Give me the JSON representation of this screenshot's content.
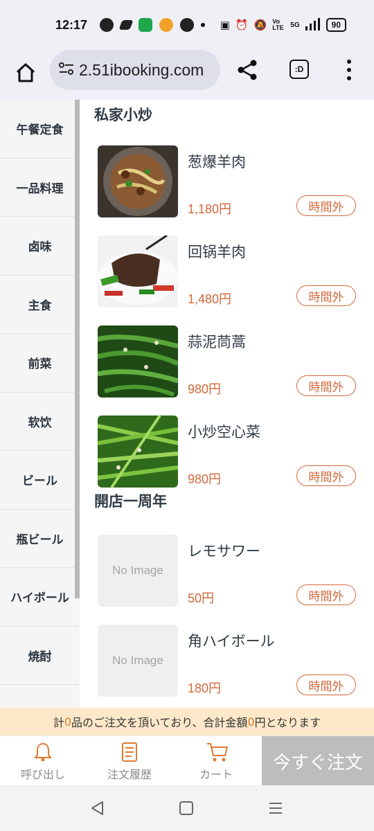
{
  "status_bar": {
    "time": "12:17",
    "signal_text": "5G",
    "volte_text": "Vo LTE",
    "battery": "90"
  },
  "browser": {
    "url": "2.51ibooking.com",
    "tab_label": ":D"
  },
  "sidebar": {
    "items": [
      {
        "label": "午餐定食"
      },
      {
        "label": "一品料理"
      },
      {
        "label": "卤味"
      },
      {
        "label": "主食"
      },
      {
        "label": "前菜"
      },
      {
        "label": "软饮"
      },
      {
        "label": "ビール"
      },
      {
        "label": "瓶ビール"
      },
      {
        "label": "ハイボール"
      },
      {
        "label": "焼酎"
      }
    ]
  },
  "sections": [
    {
      "title": "私家小炒",
      "items": [
        {
          "name": "葱爆羊肉",
          "price": "1,180円",
          "badge": "時間外",
          "image": "lamb-scallion"
        },
        {
          "name": "回锅羊肉",
          "price": "1,480円",
          "badge": "時間外",
          "image": "twice-cooked-lamb"
        },
        {
          "name": "蒜泥茼蒿",
          "price": "980円",
          "badge": "時間外",
          "image": "garlic-greens"
        },
        {
          "name": "小炒空心菜",
          "price": "980円",
          "badge": "時間外",
          "image": "water-spinach"
        }
      ]
    },
    {
      "title": "開店一周年",
      "items": [
        {
          "name": "レモサワー",
          "price": "50円",
          "badge": "時間外",
          "image_text": "No Image"
        },
        {
          "name": "角ハイボール",
          "price": "180円",
          "badge": "時間外",
          "image_text": "No Image"
        }
      ]
    }
  ],
  "summary": {
    "prefix": "計",
    "count": "0",
    "middle": "品のご注文を頂いており、合計金額",
    "total": "0",
    "suffix": "円となります"
  },
  "bottom_nav": {
    "call": "呼び出し",
    "history": "注文履歴",
    "cart": "カート",
    "order_now": "今すぐ注文"
  },
  "colors": {
    "accent": "#d2683a",
    "summary_bg": "#fde9c9",
    "order_button_bg": "#bdbdbd"
  }
}
